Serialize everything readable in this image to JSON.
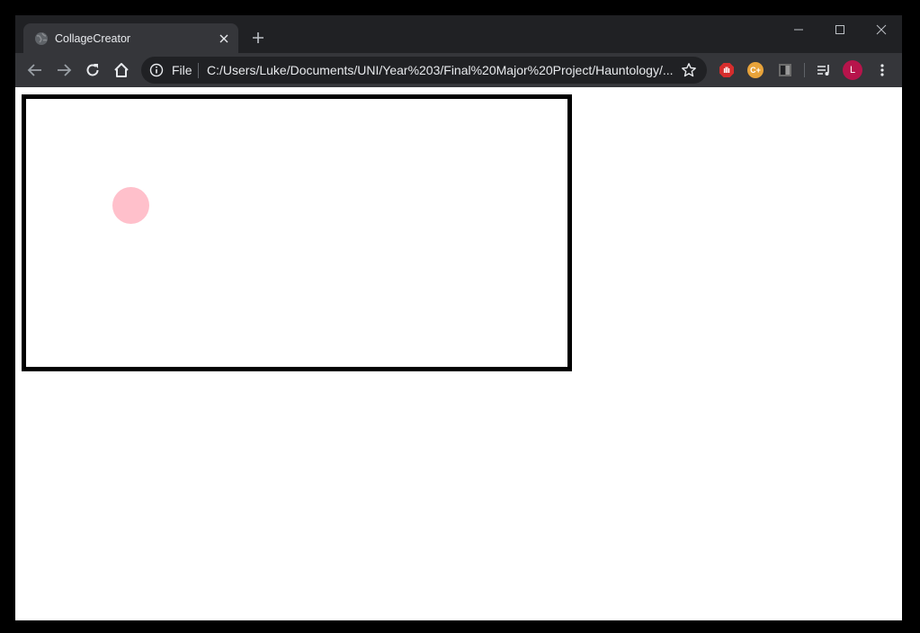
{
  "browser": {
    "tab": {
      "title": "CollageCreator",
      "favicon": "globe-icon"
    },
    "window_controls": [
      "minimize-icon",
      "maximize-icon",
      "close-icon"
    ],
    "omnibox": {
      "scheme_label": "File",
      "url": "C:/Users/Luke/Documents/UNI/Year%203/Final%20Major%20Project/Hauntology/..."
    },
    "extensions": [
      {
        "name": "adblock-icon",
        "label": "",
        "color": "#d62d2d"
      },
      {
        "name": "coupon-extension-icon",
        "label": "C+",
        "color": "#e8a33a"
      },
      {
        "name": "reader-extension-icon",
        "label": "",
        "color": "#6b6b6b"
      }
    ],
    "profile": {
      "initial": "L",
      "color": "#b7144b"
    }
  },
  "page": {
    "canvas_border_color": "#000000",
    "circle_color": "#ffc0cb"
  }
}
